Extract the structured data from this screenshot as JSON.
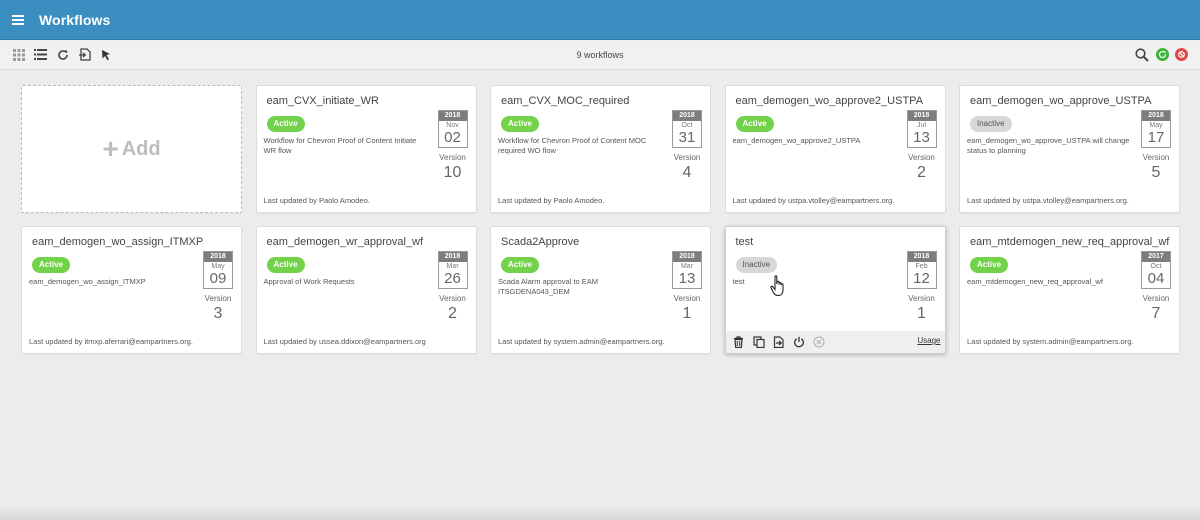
{
  "header": {
    "title": "Workflows"
  },
  "toolbar": {
    "count_label": "9 workflows",
    "left_icons": [
      "grid-view-icon",
      "list-view-icon",
      "refresh-icon",
      "import-icon",
      "select-cursor-icon"
    ],
    "right_icons": [
      "search-icon",
      "running-status-icon",
      "stopped-status-icon"
    ],
    "colors": {
      "running": "#3bb53b",
      "stopped": "#e24848"
    }
  },
  "add_card": {
    "label": "Add"
  },
  "workflows": [
    {
      "title": "eam_CVX_initiate_WR",
      "status": "Active",
      "description": "Workflow for Chevron Proof of Content Initiate WR flow",
      "year": "2018",
      "month": "Nov",
      "day": "02",
      "version_label": "Version",
      "version": "10",
      "updated": "Last updated by Paolo Amodeo."
    },
    {
      "title": "eam_CVX_MOC_required",
      "status": "Active",
      "description": "Workflow for Chevron Proof of Content MOC required WO flow",
      "year": "2018",
      "month": "Oct",
      "day": "31",
      "version_label": "Version",
      "version": "4",
      "updated": "Last updated by Paolo Amodeo."
    },
    {
      "title": "eam_demogen_wo_approve2_USTPA",
      "status": "Active",
      "description": "eam_demogen_wo_approve2_USTPA",
      "year": "2018",
      "month": "Jul",
      "day": "13",
      "version_label": "Version",
      "version": "2",
      "updated": "Last updated by ustpa.vtolley@eampartners.org."
    },
    {
      "title": "eam_demogen_wo_approve_USTPA",
      "status": "Inactive",
      "description": "eam_demogen_wo_approve_USTPA will change status to planning",
      "year": "2018",
      "month": "May",
      "day": "17",
      "version_label": "Version",
      "version": "5",
      "updated": "Last updated by ustpa.vtolley@eampartners.org."
    },
    {
      "title": "eam_demogen_wo_assign_ITMXP",
      "status": "Active",
      "description": "eam_demogen_wo_assign_ITMXP",
      "year": "2018",
      "month": "May",
      "day": "09",
      "version_label": "Version",
      "version": "3",
      "updated": "Last updated by itmxp.aferrari@eampartners.org."
    },
    {
      "title": "eam_demogen_wr_approval_wf",
      "status": "Active",
      "description": "Approval of Work Requests",
      "year": "2018",
      "month": "Mar",
      "day": "26",
      "version_label": "Version",
      "version": "2",
      "updated": "Last updated by ussea.ddixon@eampartners.org"
    },
    {
      "title": "Scada2Approve",
      "status": "Active",
      "description": "Scada Alarm approval to EAM ITSGDENA043_DEM",
      "year": "2018",
      "month": "Mar",
      "day": "13",
      "version_label": "Version",
      "version": "1",
      "updated": "Last updated by system.admin@eampartners.org."
    },
    {
      "title": "test",
      "status": "Inactive",
      "description": "test",
      "year": "2018",
      "month": "Feb",
      "day": "12",
      "version_label": "Version",
      "version": "1",
      "updated": "",
      "hovered": true,
      "actions": [
        "delete-icon",
        "copy-icon",
        "export-icon",
        "power-icon",
        "cancel-icon"
      ],
      "usage_label": "Usage"
    },
    {
      "title": "eam_mtdemogen_new_req_approval_wf",
      "status": "Active",
      "description": "eam_mtdemogen_new_req_approval_wf",
      "year": "2017",
      "month": "Oct",
      "day": "04",
      "version_label": "Version",
      "version": "7",
      "updated": "Last updated by system.admin@eampartners.org."
    }
  ],
  "colors": {
    "header": "#3a8fc0",
    "active": "#72d34b",
    "inactive": "#d7d7d7"
  }
}
